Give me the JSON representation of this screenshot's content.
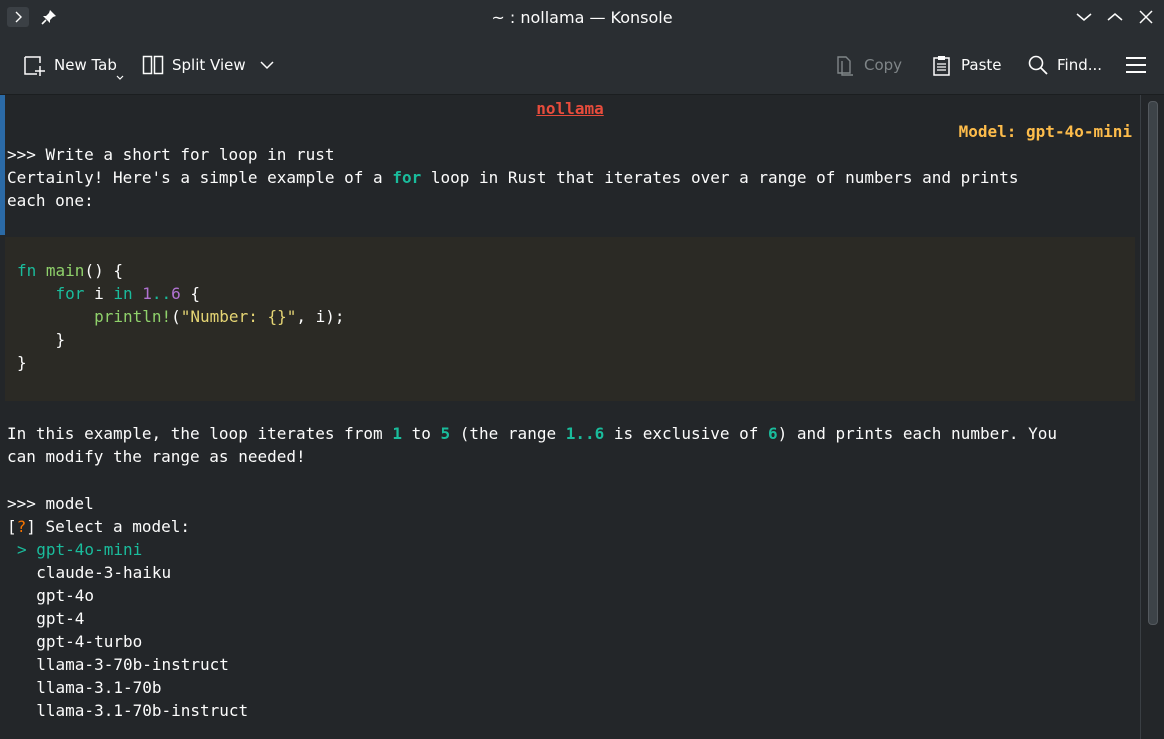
{
  "window": {
    "title": "~ : nollama — Konsole"
  },
  "toolbar": {
    "new_tab": "New Tab",
    "split_view": "Split View",
    "copy": "Copy",
    "paste": "Paste",
    "find": "Find..."
  },
  "terminal": {
    "header_title": "nollama",
    "header_model": "Model: gpt-4o-mini",
    "prompt1": ">>> Write a short for loop in rust",
    "resp1_a": "Certainly! Here's a simple example of a ",
    "resp1_kw": "for",
    "resp1_b": " loop in Rust that iterates over a range of numbers and prints",
    "resp1_c": "each one:",
    "code": {
      "l1_kw": "fn",
      "l1_fn": "main",
      "l1_rest": "() {",
      "l2_indent": "    ",
      "l2_kw": "for",
      "l2_mid": " i ",
      "l2_in": "in",
      "l2_sp": " ",
      "l2_n1": "1",
      "l2_dots": "..",
      "l2_n2": "6",
      "l2_end": " {",
      "l3_indent": "        ",
      "l3_macro": "println!",
      "l3_open": "(",
      "l3_str": "\"Number: {}\"",
      "l3_rest": ", i);",
      "l4": "    }",
      "l5": "}"
    },
    "resp2": {
      "a": "In this example, the loop iterates from ",
      "n1": "1",
      "b": " to ",
      "n2": "5",
      "c": " (the range ",
      "range": "1..6",
      "d": " is exclusive of ",
      "n3": "6",
      "e": ") and prints each number. You",
      "f": "can modify the range as needed!"
    },
    "prompt2": ">>> model",
    "select_open": "[",
    "select_q": "?",
    "select_close": "] Select a model:",
    "models": [
      {
        "label": "> gpt-4o-mini",
        "selected": true
      },
      {
        "label": "  claude-3-haiku",
        "selected": false
      },
      {
        "label": "  gpt-4o",
        "selected": false
      },
      {
        "label": "  gpt-4",
        "selected": false
      },
      {
        "label": "  gpt-4-turbo",
        "selected": false
      },
      {
        "label": "  llama-3-70b-instruct",
        "selected": false
      },
      {
        "label": "  llama-3.1-70b",
        "selected": false
      },
      {
        "label": "  llama-3.1-70b-instruct",
        "selected": false
      }
    ]
  }
}
